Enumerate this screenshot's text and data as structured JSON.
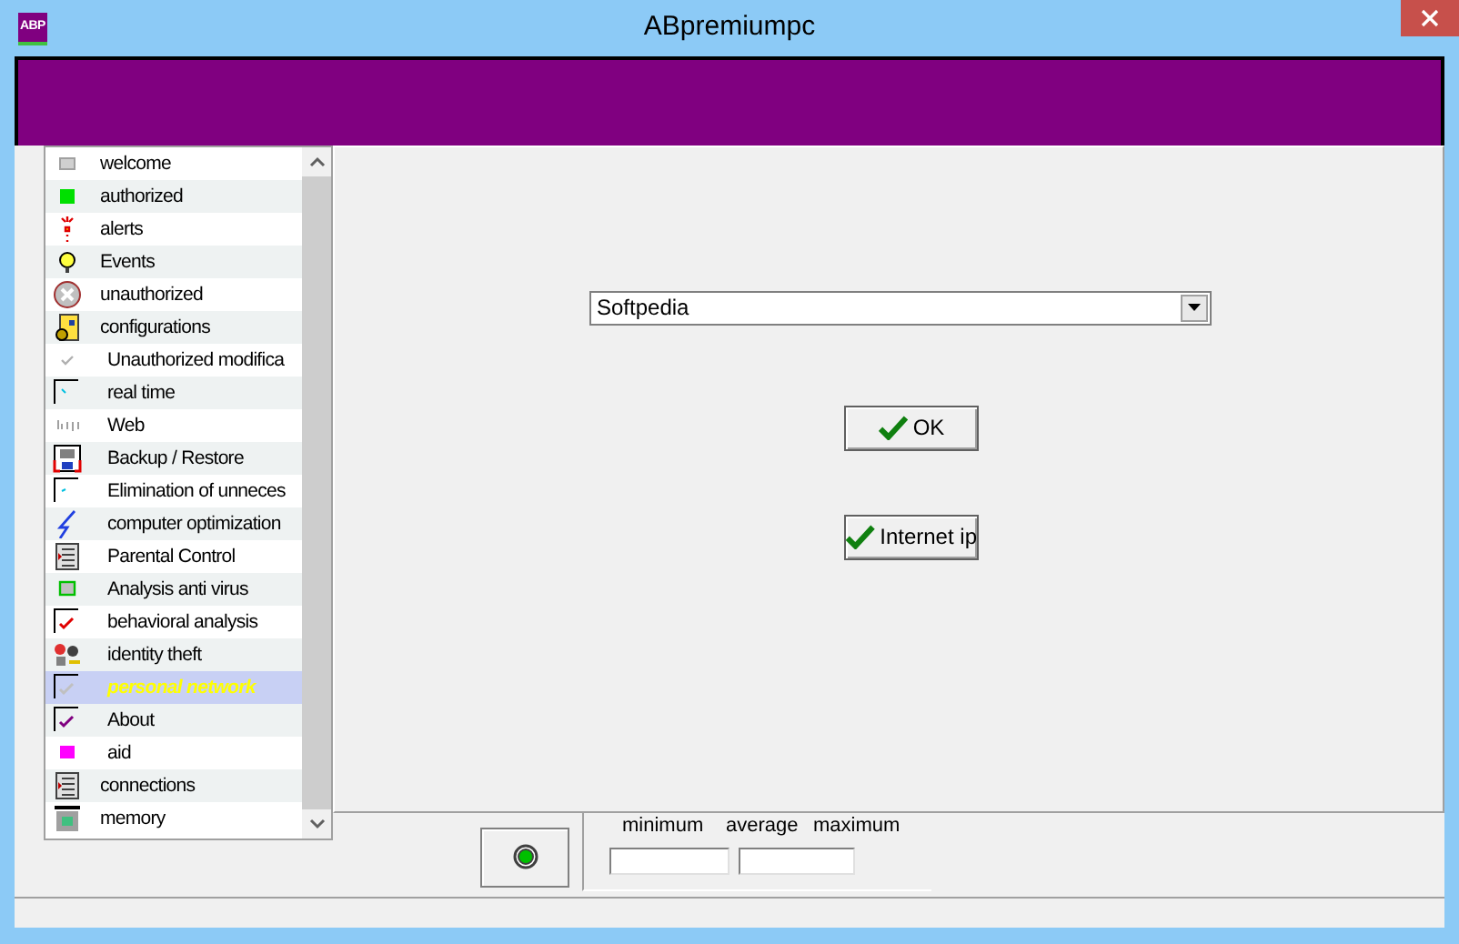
{
  "window": {
    "title": "ABpremiumpc",
    "app_icon": "ABP"
  },
  "sidebar": {
    "items": [
      {
        "label": "welcome",
        "selected": false
      },
      {
        "label": "authorized",
        "selected": false
      },
      {
        "label": "alerts",
        "selected": false
      },
      {
        "label": "Events",
        "selected": false
      },
      {
        "label": "unauthorized",
        "selected": false
      },
      {
        "label": "configurations",
        "selected": false,
        "children": [
          {
            "label": "Unauthorized modifica",
            "selected": false
          },
          {
            "label": "real time",
            "selected": false
          },
          {
            "label": "Web",
            "selected": false
          },
          {
            "label": "Backup / Restore",
            "selected": false
          },
          {
            "label": "Elimination of unneces",
            "selected": false
          },
          {
            "label": "computer optimization",
            "selected": false
          },
          {
            "label": "Parental Control",
            "selected": false
          },
          {
            "label": "Analysis anti virus",
            "selected": false
          },
          {
            "label": "behavioral analysis",
            "selected": false
          },
          {
            "label": "identity theft",
            "selected": false
          },
          {
            "label": "personal network",
            "selected": true
          },
          {
            "label": "About",
            "selected": false
          },
          {
            "label": "aid",
            "selected": false
          }
        ]
      },
      {
        "label": "connections",
        "selected": false
      },
      {
        "label": "memory",
        "selected": false
      }
    ]
  },
  "main": {
    "dropdown": {
      "value": "Softpedia"
    },
    "buttons": [
      {
        "label": "OK"
      },
      {
        "label": "Internet ip"
      }
    ]
  },
  "stats": {
    "labels": [
      "minimum",
      "average",
      "maximum"
    ]
  }
}
